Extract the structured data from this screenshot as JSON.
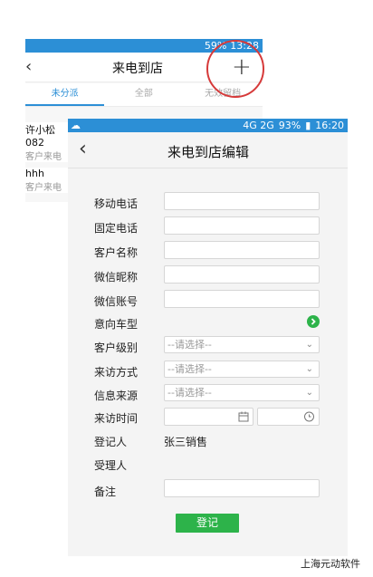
{
  "background_screen": {
    "status": {
      "battery": "59%",
      "time": "13:28"
    },
    "nav": {
      "back_icon": "chevron-left-icon",
      "title": "来电到店",
      "add_icon": "plus-icon"
    },
    "tabs": [
      "未分派",
      "全部",
      "无效留档"
    ],
    "rows": [
      {
        "name": "许小松082",
        "source": "客户来电"
      },
      {
        "name": "hhh",
        "source": "客户来电"
      }
    ]
  },
  "status_bar": {
    "left_icon": "app-icon",
    "network": "4G 2G",
    "battery": "93%",
    "time": "16:20"
  },
  "nav": {
    "back_icon": "chevron-left-icon",
    "title": "来电到店编辑"
  },
  "form": {
    "mobile_label": "移动电话",
    "landline_label": "固定电话",
    "customer_name_label": "客户名称",
    "wechat_nickname_label": "微信昵称",
    "wechat_account_label": "微信账号",
    "intended_model_label": "意向车型",
    "customer_level_label": "客户级别",
    "visit_method_label": "来访方式",
    "info_source_label": "信息来源",
    "visit_time_label": "来访时间",
    "registrant_label": "登记人",
    "registrant_value": "张三销售",
    "receiver_label": "受理人",
    "remarks_label": "备注",
    "select_placeholder": "--请选择--",
    "submit_label": "登记"
  },
  "colors": {
    "accent": "#2c8fd6",
    "submit": "#2db34a",
    "highlight": "#d63a3a"
  },
  "watermark": "上海元动软件"
}
